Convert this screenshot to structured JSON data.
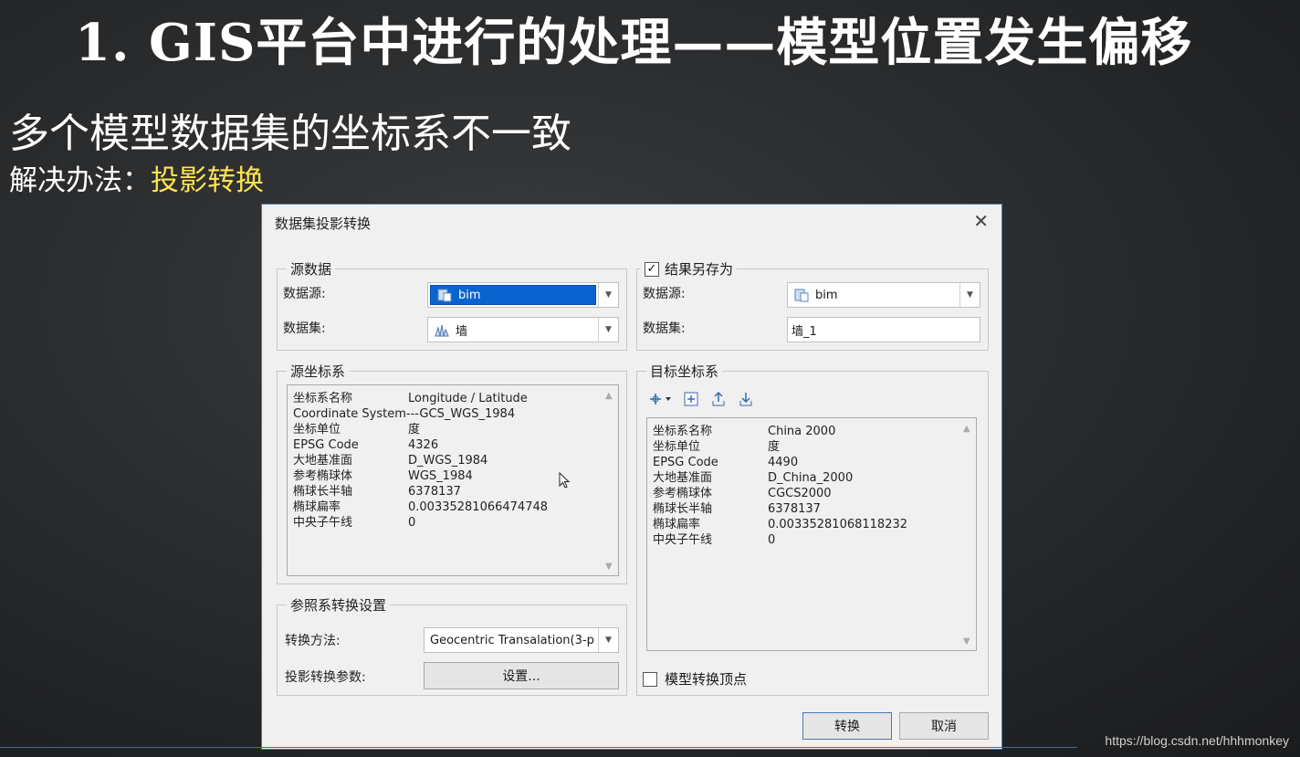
{
  "slide": {
    "title": "1. GIS平台中进行的处理——模型位置发生偏移",
    "subtitle": "多个模型数据集的坐标系不一致",
    "solution_label": "解决办法：",
    "solution_value": "投影转换",
    "watermark": "https://blog.csdn.net/hhhmonkey"
  },
  "dialog": {
    "title": "数据集投影转换",
    "source_data": {
      "group_label": "源数据",
      "datasource_label": "数据源:",
      "datasource_value": "bim",
      "dataset_label": "数据集:",
      "dataset_value": "墙"
    },
    "result": {
      "checkbox_label": "结果另存为",
      "checked_mark": "✓",
      "datasource_label": "数据源:",
      "datasource_value": "bim",
      "dataset_label": "数据集:",
      "dataset_value": "墙_1"
    },
    "source_crs": {
      "group_label": "源坐标系",
      "rows": [
        {
          "k": "坐标系名称",
          "v": "Longitude / Latitude"
        },
        {
          "k": "Coordinate System---GCS_WGS_1984",
          "v": ""
        },
        {
          "k": "坐标单位",
          "v": "度"
        },
        {
          "k": "EPSG Code",
          "v": "4326"
        },
        {
          "k": "大地基准面",
          "v": "D_WGS_1984"
        },
        {
          "k": "参考椭球体",
          "v": "WGS_1984"
        },
        {
          "k": "椭球长半轴",
          "v": "6378137"
        },
        {
          "k": "椭球扁率",
          "v": "0.00335281066474748"
        },
        {
          "k": "中央子午线",
          "v": "0"
        }
      ]
    },
    "target_crs": {
      "group_label": "目标坐标系",
      "rows": [
        {
          "k": "坐标系名称",
          "v": "China 2000"
        },
        {
          "k": "坐标单位",
          "v": "度"
        },
        {
          "k": "EPSG Code",
          "v": "4490"
        },
        {
          "k": "大地基准面",
          "v": "D_China_2000"
        },
        {
          "k": "参考椭球体",
          "v": "CGCS2000"
        },
        {
          "k": "椭球长半轴",
          "v": "6378137"
        },
        {
          "k": "椭球扁率",
          "v": "0.00335281068118232"
        },
        {
          "k": "中央子午线",
          "v": "0"
        }
      ]
    },
    "transform": {
      "group_label": "参照系转换设置",
      "method_label": "转换方法:",
      "method_value": "Geocentric Transalation(3-p",
      "params_label": "投影转换参数:",
      "params_button": "设置..."
    },
    "vertex_checkbox_label": "模型转换顶点",
    "convert_button": "转换",
    "cancel_button": "取消",
    "colors": {
      "selection_blue": "#0a64d0",
      "highlight_yellow": "#ffe34d",
      "dialog_bg": "#f0f0f0"
    }
  }
}
